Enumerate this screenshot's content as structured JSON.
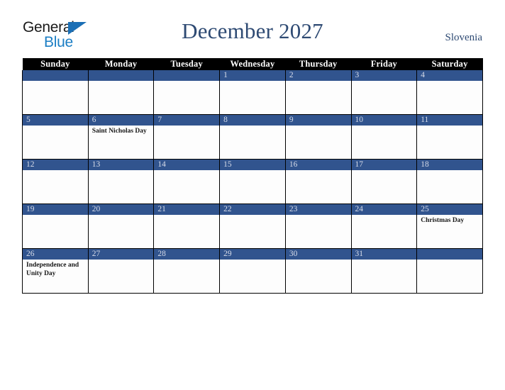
{
  "brand": {
    "line1": "General",
    "line2": "Blue",
    "triangle_icon": "blue-triangle-icon",
    "triangle_color": "#1b6fb5",
    "line2_color": "#1b7ec4"
  },
  "header": {
    "month_title": "December 2027",
    "country": "Slovenia",
    "title_color": "#2e4a73"
  },
  "theme": {
    "band_blue": "#31548e",
    "header_black": "#000000",
    "day_number_color": "#d6dbe8",
    "cell_background": "#fdfdfd",
    "border_color": "#000000"
  },
  "weekday_headers": [
    "Sunday",
    "Monday",
    "Tuesday",
    "Wednesday",
    "Thursday",
    "Friday",
    "Saturday"
  ],
  "weeks": [
    [
      {
        "day": "",
        "event": ""
      },
      {
        "day": "",
        "event": ""
      },
      {
        "day": "",
        "event": ""
      },
      {
        "day": "1",
        "event": ""
      },
      {
        "day": "2",
        "event": ""
      },
      {
        "day": "3",
        "event": ""
      },
      {
        "day": "4",
        "event": ""
      }
    ],
    [
      {
        "day": "5",
        "event": ""
      },
      {
        "day": "6",
        "event": "Saint Nicholas Day"
      },
      {
        "day": "7",
        "event": ""
      },
      {
        "day": "8",
        "event": ""
      },
      {
        "day": "9",
        "event": ""
      },
      {
        "day": "10",
        "event": ""
      },
      {
        "day": "11",
        "event": ""
      }
    ],
    [
      {
        "day": "12",
        "event": ""
      },
      {
        "day": "13",
        "event": ""
      },
      {
        "day": "14",
        "event": ""
      },
      {
        "day": "15",
        "event": ""
      },
      {
        "day": "16",
        "event": ""
      },
      {
        "day": "17",
        "event": ""
      },
      {
        "day": "18",
        "event": ""
      }
    ],
    [
      {
        "day": "19",
        "event": ""
      },
      {
        "day": "20",
        "event": ""
      },
      {
        "day": "21",
        "event": ""
      },
      {
        "day": "22",
        "event": ""
      },
      {
        "day": "23",
        "event": ""
      },
      {
        "day": "24",
        "event": ""
      },
      {
        "day": "25",
        "event": "Christmas Day"
      }
    ],
    [
      {
        "day": "26",
        "event": "Independence and Unity Day"
      },
      {
        "day": "27",
        "event": ""
      },
      {
        "day": "28",
        "event": ""
      },
      {
        "day": "29",
        "event": ""
      },
      {
        "day": "30",
        "event": ""
      },
      {
        "day": "31",
        "event": ""
      },
      {
        "day": "",
        "event": ""
      }
    ]
  ]
}
